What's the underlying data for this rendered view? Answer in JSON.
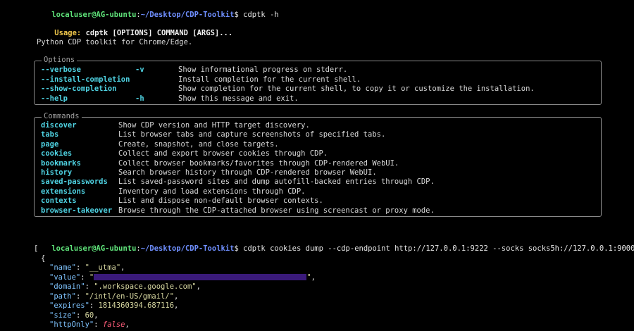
{
  "prompt1": {
    "user": "localuser@AG-ubuntu",
    "sep": ":",
    "path": "~/Desktop/CDP-Toolkit",
    "dollar": "$",
    "command": " cdptk -h"
  },
  "usage": {
    "label": "Usage:",
    "text": "cdptk [OPTIONS] COMMAND [ARGS]..."
  },
  "description": "Python CDP toolkit for Chrome/Edge.",
  "options": {
    "title": "Options",
    "items": [
      {
        "flag": "--verbose",
        "short": "-v",
        "desc": "Show informational progress on stderr."
      },
      {
        "flag": "--install-completion",
        "short": "",
        "desc": "Install completion for the current shell."
      },
      {
        "flag": "--show-completion",
        "short": "",
        "desc": "Show completion for the current shell, to copy it or customize the installation."
      },
      {
        "flag": "--help",
        "short": "-h",
        "desc": "Show this message and exit."
      }
    ]
  },
  "commands": {
    "title": "Commands",
    "items": [
      {
        "name": "discover",
        "desc": "Show CDP version and HTTP target discovery."
      },
      {
        "name": "tabs",
        "desc": "List browser tabs and capture screenshots of specified tabs."
      },
      {
        "name": "page",
        "desc": "Create, snapshot, and close targets."
      },
      {
        "name": "cookies",
        "desc": "Collect and export browser cookies through CDP."
      },
      {
        "name": "bookmarks",
        "desc": "Collect browser bookmarks/favorites through CDP-rendered WebUI."
      },
      {
        "name": "history",
        "desc": "Search browser history through CDP-rendered browser WebUI."
      },
      {
        "name": "saved-passwords",
        "desc": "List saved-password sites and dump autofill-backed entries through CDP."
      },
      {
        "name": "extensions",
        "desc": "Inventory and load extensions through CDP."
      },
      {
        "name": "contexts",
        "desc": "List and dispose non-default browser contexts."
      },
      {
        "name": "browser-takeover",
        "desc": "Browse through the CDP-attached browser using screencast or proxy mode."
      }
    ]
  },
  "prompt2": {
    "user": "localuser@AG-ubuntu",
    "sep": ":",
    "path": "~/Desktop/CDP-Toolkit",
    "dollar": "$",
    "command": " cdptk cookies dump --cdp-endpoint http://127.0.0.1:9222 --socks socks5h://127.0.0.1:9000"
  },
  "json_output": {
    "open_bracket": "[",
    "open_brace": "{",
    "fields": [
      {
        "key": "\"name\"",
        "value": "\"__utma\"",
        "type": "str"
      },
      {
        "key": "\"value\"",
        "value": "",
        "type": "redacted"
      },
      {
        "key": "\"domain\"",
        "value": "\".workspace.google.com\"",
        "type": "str"
      },
      {
        "key": "\"path\"",
        "value": "\"/intl/en-US/gmail/\"",
        "type": "str"
      },
      {
        "key": "\"expires\"",
        "value": "1814360394.687116",
        "type": "num"
      },
      {
        "key": "\"size\"",
        "value": "60",
        "type": "num"
      },
      {
        "key": "\"httpOnly\"",
        "value": "false",
        "type": "false"
      }
    ]
  },
  "colors": {
    "background": "#000000",
    "user": "#5fe37a",
    "path": "#6f8fff",
    "accent": "#4fd3e3",
    "usage": "#f2c94c",
    "false": "#ff5d7a",
    "redaction": "#3a1a7a"
  }
}
